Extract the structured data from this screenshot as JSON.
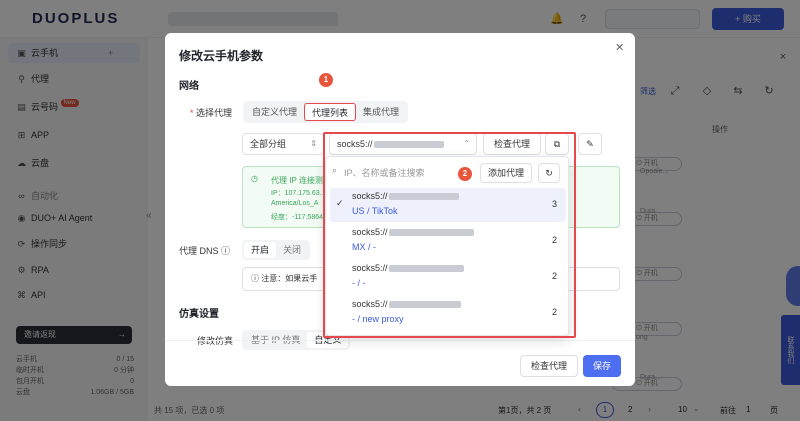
{
  "app": {
    "logo": "DUOPLUS",
    "buy_label": "+ 购买"
  },
  "sidebar": {
    "items": [
      {
        "label": "云手机",
        "icon": "phone-icon"
      },
      {
        "label": "代理",
        "icon": "proxy-icon"
      },
      {
        "label": "云号码",
        "icon": "sim-icon",
        "badge": "New"
      },
      {
        "label": "APP",
        "icon": "apps-icon"
      },
      {
        "label": "云盘",
        "icon": "cloud-icon"
      },
      {
        "label": "自动化",
        "icon": "automation-icon"
      },
      {
        "label": "DUO+ AI Agent",
        "icon": "robot-icon"
      },
      {
        "label": "操作同步",
        "icon": "sync-icon"
      },
      {
        "label": "RPA",
        "icon": "rpa-icon"
      },
      {
        "label": "API",
        "icon": "api-icon"
      }
    ],
    "invite_label": "邀请返现",
    "stats": [
      {
        "label": "云手机",
        "value": "0 / 15"
      },
      {
        "label": "临时开机",
        "value": "0 分钟"
      },
      {
        "label": "包月开机",
        "value": "0"
      },
      {
        "label": "云盘",
        "value": "1.06GB / 5GB"
      }
    ]
  },
  "background": {
    "column_header": "操作",
    "row_button": "开机",
    "row_texts": [
      "Opoale...",
      "Dura...",
      "",
      "",
      "",
      "ong",
      "Dura..."
    ],
    "filter_label": "筛选",
    "pagination": {
      "summary": "共 15 项，已选 0 项",
      "range": "第1页，共 2 页",
      "pages": [
        "1",
        "2"
      ],
      "page_size": "10",
      "goto_label": "前往",
      "goto_value": "1",
      "page_suffix": "页"
    },
    "chat_label": "联系我们"
  },
  "modal": {
    "title": "修改云手机参数",
    "close_icon": "close-icon",
    "network_section": "网络",
    "proxy_label": "选择代理",
    "proxy_tabs": [
      "自定义代理",
      "代理列表",
      "集成代理"
    ],
    "active_tab": 1,
    "group_select": "全部分组",
    "proxy_select": "socks5://",
    "check_proxy_label": "检查代理",
    "info_lines": [
      "代理 IP 连接测试",
      "IP：107.175.63.1",
      "America/Los_A",
      "经度：-117.5864"
    ],
    "dns_label": "代理 DNS",
    "dns_options": [
      "开启",
      "关闭"
    ],
    "dns_note": "注意：如果云手",
    "sim_section": "仿真设置",
    "sim_label": "修改仿真",
    "sim_options": [
      "基于 IP 仿真",
      "自定义"
    ],
    "footer_check_label": "检查代理",
    "save_label": "保存",
    "annotations": [
      "1",
      "2"
    ]
  },
  "dropdown": {
    "search_placeholder": "IP、名称或备注搜索",
    "add_proxy_label": "添加代理",
    "items": [
      {
        "line1": "socks5://",
        "line2": "US / TikTok",
        "count": "3",
        "selected": true
      },
      {
        "line1": "socks5://",
        "line2": "MX / -",
        "count": "2",
        "selected": false
      },
      {
        "line1": "socks5://",
        "line2": "- / -",
        "count": "2",
        "selected": false
      },
      {
        "line1": "socks5://",
        "line2": "- / new proxy",
        "count": "2",
        "selected": false
      }
    ]
  },
  "colors": {
    "primary": "#4e6ef2",
    "highlight": "#e5484d",
    "success": "#3aa55a"
  }
}
